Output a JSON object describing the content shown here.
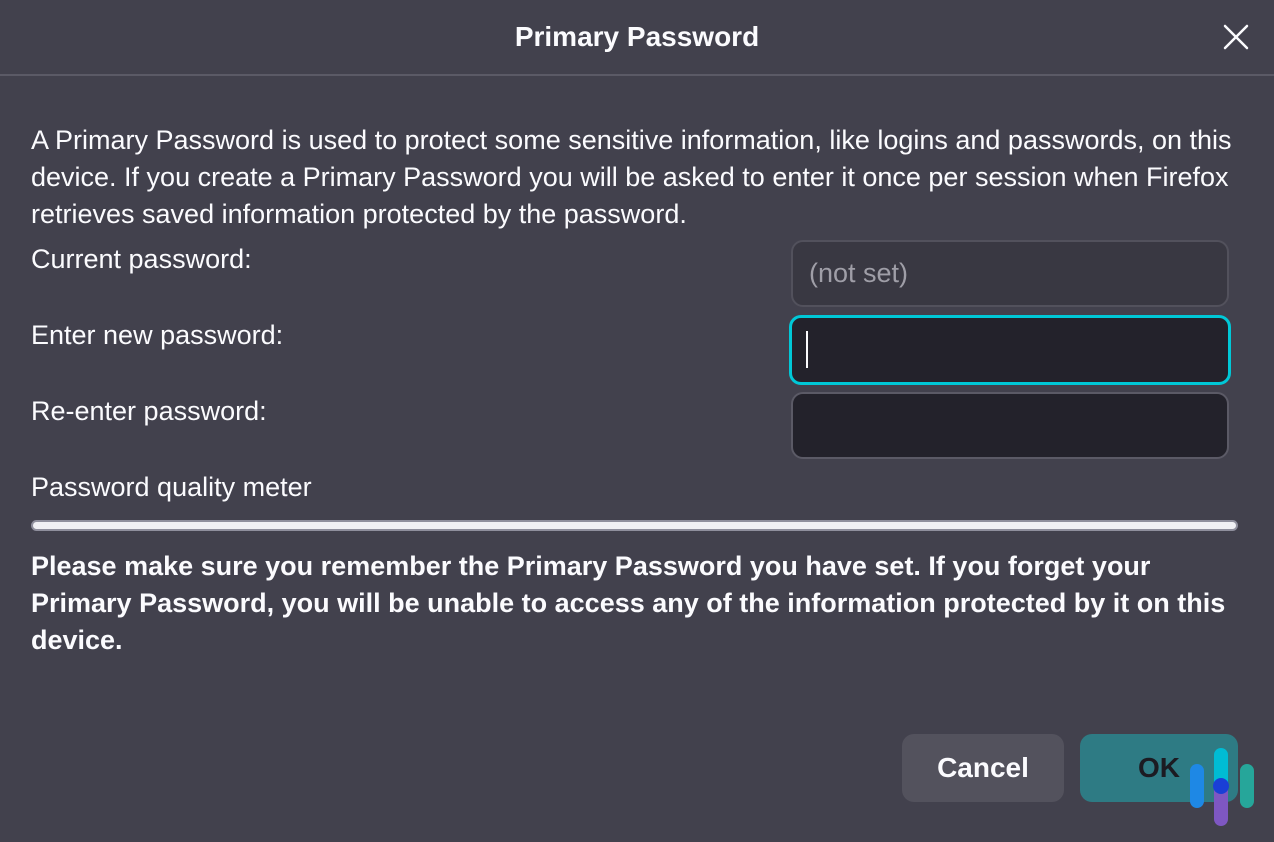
{
  "dialog": {
    "title": "Primary Password",
    "description": "A Primary Password is used to protect some sensitive information, like logins and passwords, on this device. If you create a Primary Password you will be asked to enter it once per session when Firefox retrieves saved information protected by the password.",
    "fields": {
      "current_label": "Current password:",
      "current_placeholder": "(not set)",
      "new_label": "Enter new password:",
      "new_value": "",
      "reenter_label": "Re-enter password:",
      "reenter_value": ""
    },
    "meter": {
      "label": "Password quality meter",
      "value_percent": 0
    },
    "warning": "Please make sure you remember the Primary Password you have set. If you forget your Primary Password, you will be unable to access any of the information protected by it on this device.",
    "buttons": {
      "cancel": "Cancel",
      "ok": "OK"
    }
  },
  "colors": {
    "background": "#42414d",
    "focus_accent": "#00c8d7",
    "ok_button": "#2e7b84"
  },
  "icons": {
    "close": "close-icon",
    "watermark": "brand-logo"
  }
}
